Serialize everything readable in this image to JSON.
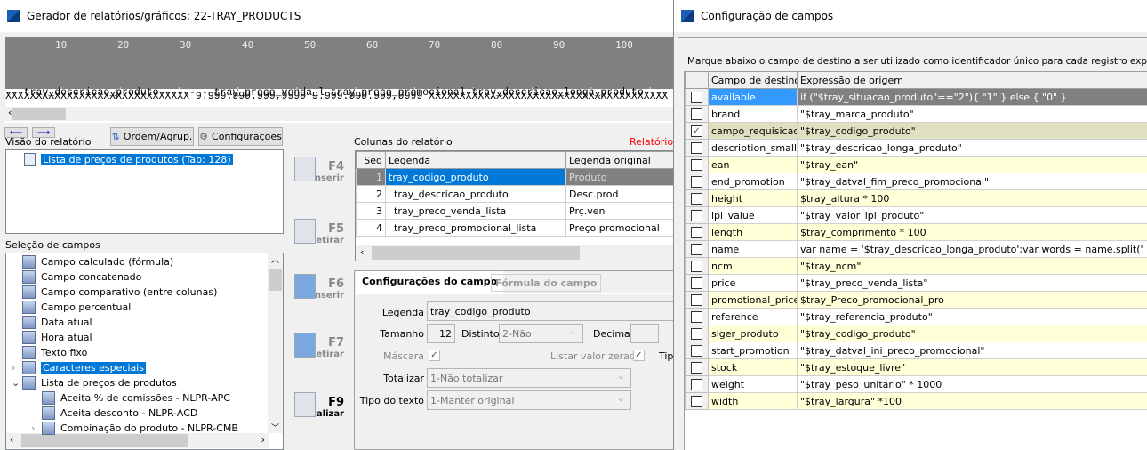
{
  "left_window": {
    "title": "Gerador de relatórios/gráficos: 22-TRAY_PRODUCTS",
    "ruler_ticks": [
      "10",
      "20",
      "30",
      "40",
      "50",
      "60",
      "70",
      "80",
      "90",
      "100"
    ],
    "preview_line1": "---tray_descricao_produto---------tray_preco_venda_l-tray_preco_promocional-tray_descricao_longa_produto----",
    "preview_line2": "  XXXXXXXXXXXXXXXXXXXXXXXXXXXXXX 9.999.999.999,9999     9.999.999.999,9999 XXXXXXXXXXXXXXXXXXXXXXXXXXXXXXXXXXXXXXX",
    "toolbar": {
      "order_label": "Ordem/Agrup.",
      "config_label": "Configurações"
    },
    "report_view": {
      "label": "Visão do relatório",
      "item": "Lista de preços de produtos (Tab: 128)"
    },
    "fields_selection": {
      "label": "Seleção de campos",
      "items": [
        "Campo calculado (fórmula)",
        "Campo concatenado",
        "Campo comparativo (entre colunas)",
        "Campo percentual",
        "Data atual",
        "Hora atual",
        "Texto fixo",
        "Caracteres especiais",
        "Lista de preços de produtos",
        "Aceita % de comissões - NLPR-APC",
        "Aceita desconto - NLPR-ACD",
        "Combinação do produto - NLPR-CMB"
      ]
    },
    "fkeys": [
      {
        "key": "F4",
        "label": "Inserir"
      },
      {
        "key": "F5",
        "label": "Retirar"
      },
      {
        "key": "F6",
        "label": "Inserir"
      },
      {
        "key": "F7",
        "label": "Retirar"
      },
      {
        "key": "F9",
        "label": "Localizar"
      }
    ],
    "columns": {
      "label": "Colunas do relatório",
      "status": "Relatório p",
      "headers": [
        "Seq",
        "Legenda",
        "Legenda original"
      ],
      "rows": [
        [
          "1",
          "tray_codigo_produto",
          "Produto"
        ],
        [
          "2",
          "tray_descricao_produto",
          "Desc.prod"
        ],
        [
          "3",
          "tray_preco_venda_lista",
          "Prç.ven"
        ],
        [
          "4",
          "tray_preco_promocional_lista",
          "Preço promocional"
        ]
      ]
    },
    "tabs": [
      "Configurações do campo",
      "Fórmula do campo"
    ],
    "form": {
      "legenda_label": "Legenda",
      "legenda": "tray_codigo_produto",
      "tamanho_label": "Tamanho",
      "tamanho": "12",
      "distinto_label": "Distinto",
      "distinto": "2-Não",
      "decimais_label": "Decimais",
      "mascara_label": "Máscara",
      "listar_label": "Listar valor zerado",
      "tipo_label": "Tipo",
      "totalizar_label": "Totalizar",
      "totalizar": "1-Não totalizar",
      "tipo_texto_label": "Tipo do texto",
      "tipo_texto": "1-Manter original"
    }
  },
  "right_window": {
    "title": "Configuração de campos",
    "instruction": "Marque abaixo o campo de destino a ser utilizado como identificador único para cada registro exportado:",
    "headers": [
      "Campo de destino",
      "Expressão de origem"
    ],
    "rows": [
      {
        "field": "available",
        "expr": "if (\"$tray_situacao_produto\"==\"2\"){ \"1\" } else { \"0\" }",
        "checked": false
      },
      {
        "field": "brand",
        "expr": "\"$tray_marca_produto\"",
        "checked": false
      },
      {
        "field": "campo_requisicao",
        "expr": "\"$tray_codigo_produto\"",
        "checked": true
      },
      {
        "field": "description_small",
        "expr": "\"$tray_descricao_longa_produto\"",
        "checked": false
      },
      {
        "field": "ean",
        "expr": "\"$tray_ean\"",
        "checked": false
      },
      {
        "field": "end_promotion",
        "expr": "\"$tray_datval_fim_preco_promocional\"",
        "checked": false
      },
      {
        "field": "height",
        "expr": "$tray_altura * 100",
        "checked": false
      },
      {
        "field": "ipi_value",
        "expr": "\"$tray_valor_ipi_produto\"",
        "checked": false
      },
      {
        "field": "length",
        "expr": "$tray_comprimento * 100",
        "checked": false
      },
      {
        "field": "name",
        "expr": "var name = '$tray_descricao_longa_produto';var words = name.split(' ');for (var i",
        "checked": false
      },
      {
        "field": "ncm",
        "expr": "\"$tray_ncm\"",
        "checked": false
      },
      {
        "field": "price",
        "expr": "\"$tray_preco_venda_lista\"",
        "checked": false
      },
      {
        "field": "promotional_price",
        "expr": "$tray_Preco_promocional_pro",
        "checked": false
      },
      {
        "field": "reference",
        "expr": "\"$tray_referencia_produto\"",
        "checked": false
      },
      {
        "field": "siger_produto",
        "expr": "\"$tray_codigo_produto\"",
        "checked": false
      },
      {
        "field": "start_promotion",
        "expr": "\"$tray_datval_ini_preco_promocional\"",
        "checked": false
      },
      {
        "field": "stock",
        "expr": "\"$tray_estoque_livre\"",
        "checked": false
      },
      {
        "field": "weight",
        "expr": "\"$tray_peso_unitario\" * 1000",
        "checked": false
      },
      {
        "field": "width",
        "expr": "\"$tray_largura\" *100",
        "checked": false
      }
    ]
  },
  "colors": {
    "selection": "#0078d7",
    "row_alt": "#ffffd8",
    "row_checked": "#e0e0c0",
    "row_current": "#808080",
    "status_red": "#ff0000"
  }
}
